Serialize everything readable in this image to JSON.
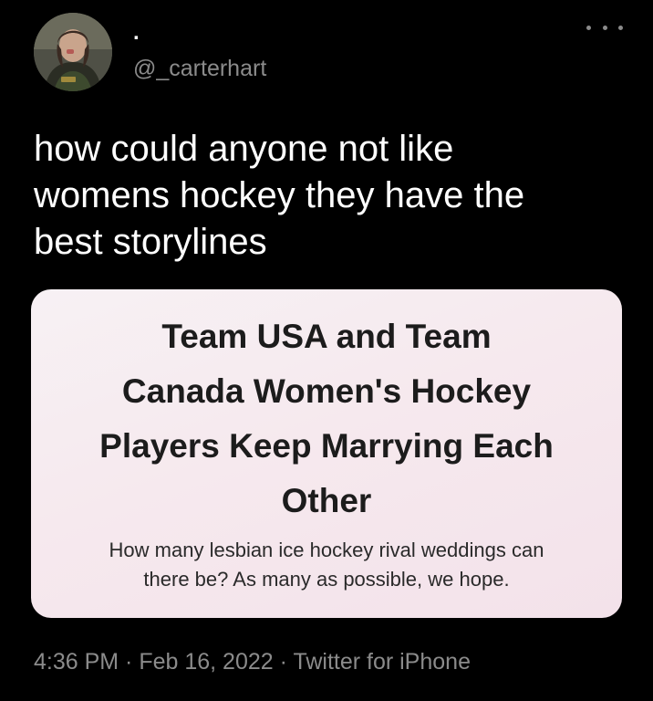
{
  "author": {
    "display_name": ".",
    "handle": "@_carterhart",
    "avatar_icon": "profile-photo"
  },
  "more_icon": "more-horizontal-icon",
  "tweet": {
    "text": "how could anyone not like\nwomens hockey they have the\nbest storylines"
  },
  "link_card": {
    "headline": "Team USA and Team\nCanada Women's Hockey\nPlayers Keep Marrying Each\nOther",
    "subtitle": "How many lesbian ice hockey rival weddings can\nthere be? As many as possible, we hope."
  },
  "meta": {
    "time": "4:36 PM",
    "separator": " · ",
    "date": "Feb 16, 2022",
    "source": "Twitter for iPhone"
  },
  "colors": {
    "background": "#000000",
    "text_primary": "#ffffff",
    "text_secondary": "#8b8b8b",
    "card_background": "#f6e9ee",
    "card_text": "#1c1c1c"
  }
}
